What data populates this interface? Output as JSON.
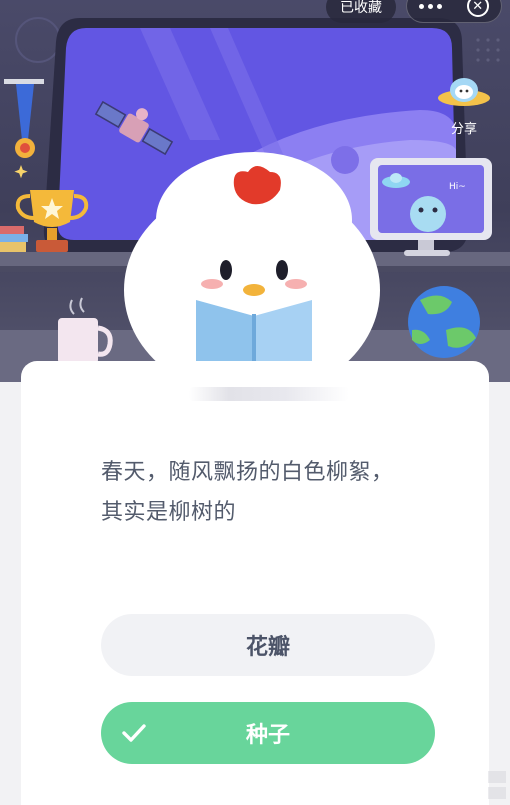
{
  "header": {
    "favorite_label": "已收藏",
    "more_icon": "more-dots-icon",
    "close_icon": "close-circle-icon",
    "share_label": "分享"
  },
  "quiz": {
    "question_line1": "春天，随风飘扬的白色柳絮，",
    "question_line2": "其实是柳树的",
    "options": [
      {
        "label": "花瓣",
        "selected": false
      },
      {
        "label": "种子",
        "selected": true
      }
    ]
  },
  "scene": {
    "tv_text": "Hi~"
  },
  "colors": {
    "correct_green": "#68d59b",
    "option_gray": "#f1f2f5",
    "question_text": "#535b6c",
    "window_purple": "#5b4fd8"
  }
}
